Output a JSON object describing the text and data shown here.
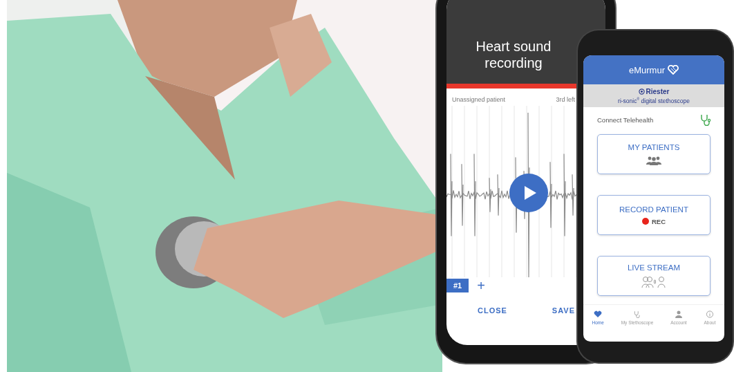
{
  "recording_screen": {
    "title": "Heart sound recording",
    "patient": "Unassigned patient",
    "position": "3rd left",
    "tracks": [
      {
        "label": "#1",
        "selected": true
      }
    ],
    "add_button": "+",
    "buttons": [
      "CLOSE",
      "SAVE"
    ]
  },
  "home_screen": {
    "app_name": "eMurmur",
    "brand": "Riester",
    "device": "ri-sonic$^{®}$ digital stethoscope",
    "connect_label": "Connect Telehealth",
    "cards": [
      {
        "label": "MY PATIENTS",
        "kind": "patients"
      },
      {
        "label": "RECORD PATIENT",
        "kind": "record",
        "badge": "REC"
      },
      {
        "label": "LIVE STREAM",
        "kind": "stream"
      }
    ],
    "nav": [
      {
        "label": "Home",
        "kind": "home",
        "selected": true
      },
      {
        "label": "My Stethoscope",
        "kind": "stethoscope",
        "selected": false
      },
      {
        "label": "Account",
        "kind": "account",
        "selected": false
      },
      {
        "label": "About",
        "kind": "about",
        "selected": false
      }
    ]
  }
}
